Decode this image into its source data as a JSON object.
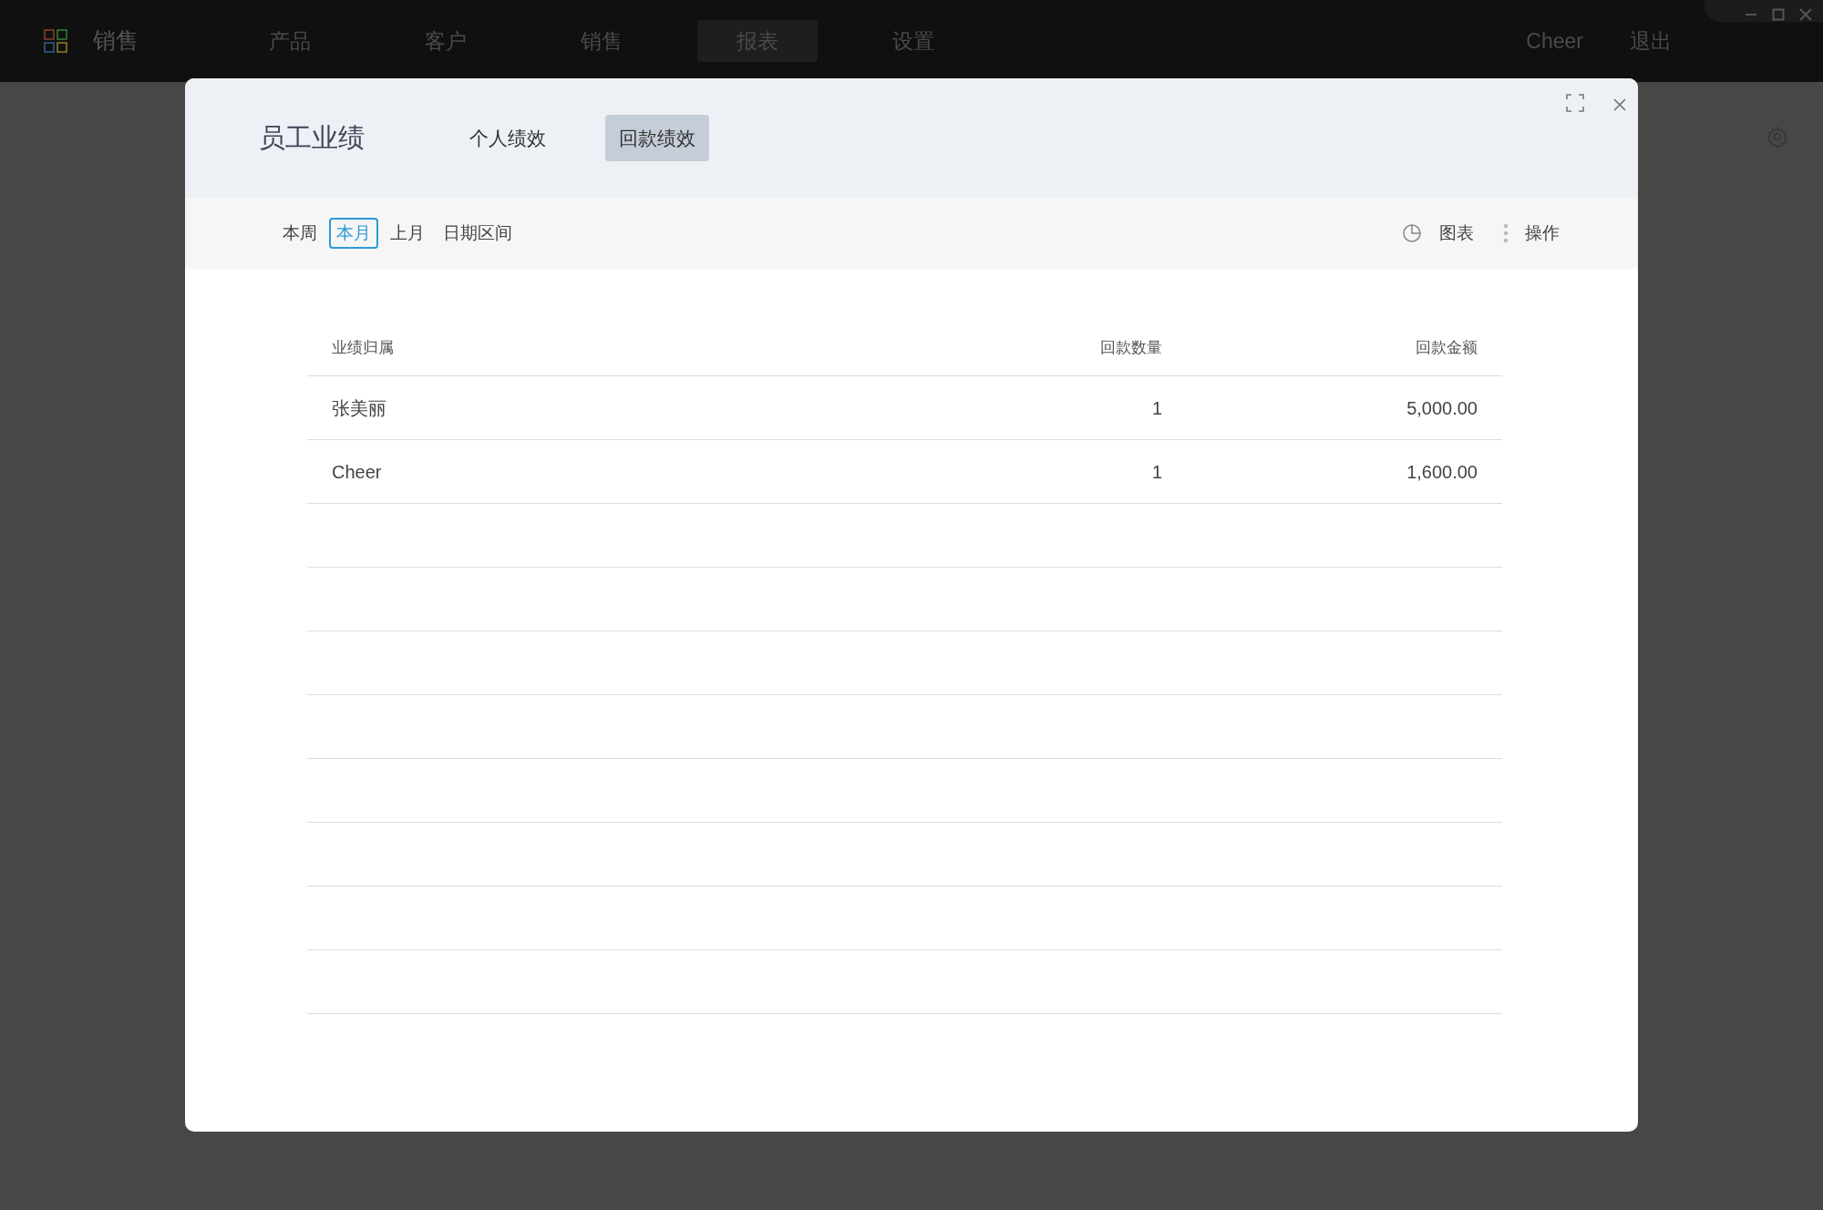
{
  "app_bar": {
    "app_name": "销售",
    "nav": [
      {
        "label": "产品",
        "selected": false
      },
      {
        "label": "客户",
        "selected": false
      },
      {
        "label": "销售",
        "selected": false
      },
      {
        "label": "报表",
        "selected": true
      },
      {
        "label": "设置",
        "selected": false
      }
    ],
    "user": "Cheer",
    "logout": "退出"
  },
  "dialog": {
    "title": "员工业绩",
    "tabs": [
      {
        "label": "个人绩效",
        "selected": false
      },
      {
        "label": "回款绩效",
        "selected": true
      }
    ],
    "periods": [
      {
        "label": "本周",
        "selected": false
      },
      {
        "label": "本月",
        "selected": true
      },
      {
        "label": "上月",
        "selected": false
      },
      {
        "label": "日期区间",
        "selected": false
      }
    ],
    "actions": [
      {
        "kind": "chart",
        "label": "图表"
      },
      {
        "kind": "more",
        "label": "操作"
      }
    ],
    "table": {
      "columns": [
        "业绩归属",
        "回款数量",
        "回款金额"
      ],
      "rows": [
        [
          "张美丽",
          "1",
          "5,000.00"
        ],
        [
          "Cheer",
          "1",
          "1,600.00"
        ]
      ]
    }
  }
}
